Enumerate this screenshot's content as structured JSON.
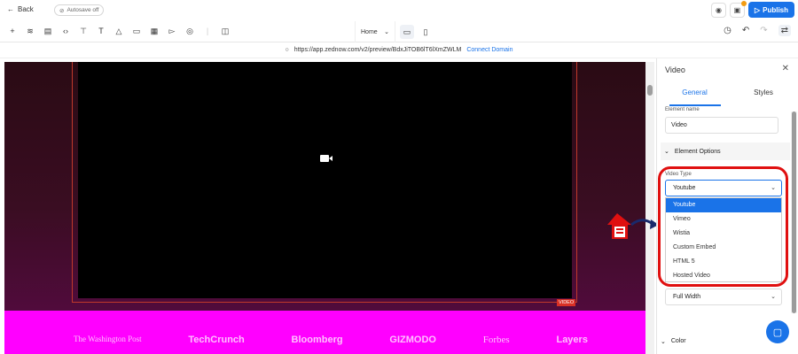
{
  "topbar": {
    "back_label": "Back",
    "autosave_label": "Autosave off",
    "publish_label": "Publish"
  },
  "toolbar": {
    "page_select": "Home"
  },
  "urlbar": {
    "url": "https://app.zednow.com/v2/preview/BdxJiTOB6lT6lXmZWLM",
    "connect_label": "Connect Domain"
  },
  "canvas": {
    "video_tag": "VIDEO",
    "logos": [
      "The Washington Post",
      "TechCrunch",
      "Bloomberg",
      "GIZMODO",
      "Forbes",
      "Layers"
    ]
  },
  "panel": {
    "title": "Video",
    "tabs": [
      "General",
      "Styles"
    ],
    "element_name_label": "Element name",
    "element_name_value": "Video",
    "section_element_options": "Element Options",
    "video_type_label": "Video Type",
    "video_type_value": "Youtube",
    "video_type_options": [
      "Youtube",
      "Vimeo",
      "Wistia",
      "Custom Embed",
      "HTML 5",
      "Hosted Video"
    ],
    "width_value": "Full Width",
    "section_color": "Color"
  },
  "colors": {
    "accent": "#1a73e8",
    "annotation_red": "#e01010",
    "canvas_magenta": "#ff00ff"
  }
}
